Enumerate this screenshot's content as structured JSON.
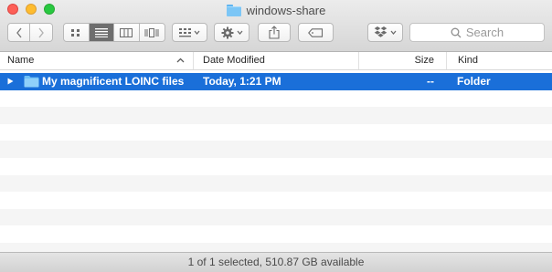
{
  "window": {
    "title": "windows-share"
  },
  "toolbar": {
    "search_placeholder": "Search"
  },
  "columns": {
    "name": "Name",
    "date_modified": "Date Modified",
    "size": "Size",
    "kind": "Kind"
  },
  "files": [
    {
      "name": "My magnificent LOINC files",
      "date_modified": "Today, 1:21 PM",
      "size": "--",
      "kind": "Folder",
      "selected": true
    }
  ],
  "status": {
    "text": "1 of 1 selected, 510.87 GB available"
  },
  "colors": {
    "selection": "#1a6fd9",
    "folder": "#7cc6f6"
  }
}
